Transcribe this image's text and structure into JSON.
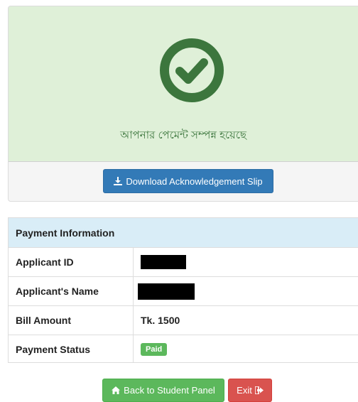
{
  "success": {
    "message": "আপনার পেমেন্ট সম্পন্ন হয়েছে",
    "icon": "check-circle-icon",
    "color": "#3c763d",
    "background": "#dff0d8"
  },
  "download_button": {
    "label": "Download Acknowledgement Slip",
    "icon": "download-icon",
    "color": "#337ab7"
  },
  "payment_info": {
    "title": "Payment Information",
    "rows": [
      {
        "label": "Applicant ID",
        "value": "",
        "redacted": true
      },
      {
        "label": "Applicant's Name",
        "value": "",
        "redacted": true
      },
      {
        "label": "Bill Amount",
        "value": "Tk. 1500"
      },
      {
        "label": "Payment Status",
        "value": "Paid",
        "badge_color": "#5cb85c"
      }
    ]
  },
  "back_button": {
    "label": "Back to Student Panel",
    "icon": "home-icon",
    "color": "#5cb85c"
  },
  "exit_button": {
    "label": "Exit",
    "icon": "sign-out-icon",
    "color": "#d9534f"
  }
}
